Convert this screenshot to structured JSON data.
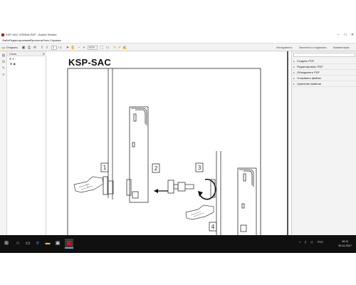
{
  "window": {
    "title": "KSP-SAC VIENNA.PDF - Adobe Reader",
    "minimize": "–",
    "maximize": "□",
    "close": "✕"
  },
  "menu": [
    "Файл",
    "Редактирование",
    "Просмотр",
    "Окно",
    "Справка"
  ],
  "toolbar": {
    "open_label": "Открыть",
    "page_current": "1",
    "page_total": "/ 1",
    "zoom": "92%",
    "tools_label": "Инструменты",
    "fill_sign_label": "Заполнить и подписать",
    "comment_label": "Комментарии"
  },
  "bookmarks": {
    "header": "Слои",
    "close": "✕",
    "tools": "⊞ ▾",
    "rows": [
      "⊞ ◉"
    ]
  },
  "document": {
    "title": "KSP-SAC",
    "step_numbers": [
      "1",
      "2",
      "3",
      "4"
    ]
  },
  "right_panel": {
    "items": [
      "Создать PDF",
      "Редактировать PDF",
      "Объединить PDF",
      "Отправить файлы",
      "Хранение файлов"
    ]
  },
  "taskbar": {
    "clock_time": "10:11",
    "clock_date": "30.11.2017",
    "lang": "РУС"
  }
}
